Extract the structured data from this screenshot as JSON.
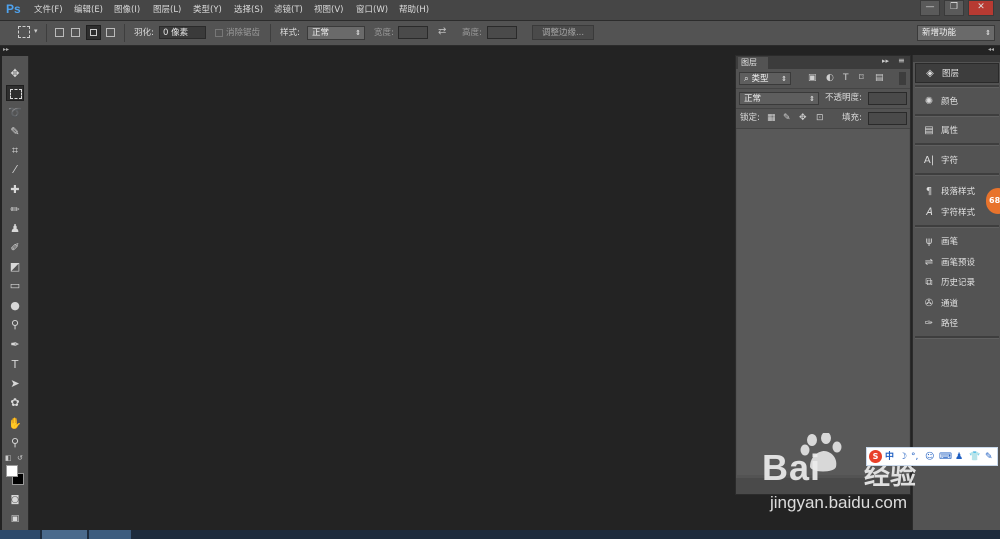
{
  "app": {
    "logo": "Ps"
  },
  "menu": [
    "文件(F)",
    "编辑(E)",
    "图像(I)",
    "图层(L)",
    "类型(Y)",
    "选择(S)",
    "滤镜(T)",
    "视图(V)",
    "窗口(W)",
    "帮助(H)"
  ],
  "window_controls": {
    "minimize": "—",
    "restore": "❐",
    "close": "✕"
  },
  "options": {
    "feather_label": "羽化:",
    "feather_value": "0 像素",
    "antialias_label": "消除锯齿",
    "style_label": "样式:",
    "style_value": "正常",
    "width_label": "宽度:",
    "height_label": "高度:",
    "refine_edge": "调整边缘...",
    "workspace": "新增功能"
  },
  "layers_panel": {
    "tab": "图层",
    "filter_kind": "类型",
    "blend_mode": "正常",
    "opacity_label": "不透明度:",
    "lock_label": "锁定:",
    "fill_label": "填充:"
  },
  "dock": {
    "items": [
      {
        "label": "图层",
        "icon": "layers-icon"
      },
      {
        "label": "颜色",
        "icon": "palette-icon"
      },
      {
        "label": "属性",
        "icon": "properties-icon"
      },
      {
        "label": "字符",
        "icon": "character-icon"
      },
      {
        "label": "段落样式",
        "icon": "paragraph-style-icon"
      },
      {
        "label": "字符样式",
        "icon": "character-style-icon"
      },
      {
        "label": "画笔",
        "icon": "brush-icon"
      },
      {
        "label": "画笔预设",
        "icon": "brush-preset-icon"
      },
      {
        "label": "历史记录",
        "icon": "history-icon"
      },
      {
        "label": "通道",
        "icon": "channels-icon"
      },
      {
        "label": "路径",
        "icon": "paths-icon"
      }
    ]
  },
  "badge": "68",
  "ime": {
    "lang": "中"
  },
  "watermark": {
    "brand": "Bai",
    "brand2": "经验",
    "url": "jingyan.baidu.com"
  },
  "colors": {
    "accent_blue": "#4fa3ef",
    "badge": "#e8732c",
    "ime_red": "#e8402a"
  }
}
